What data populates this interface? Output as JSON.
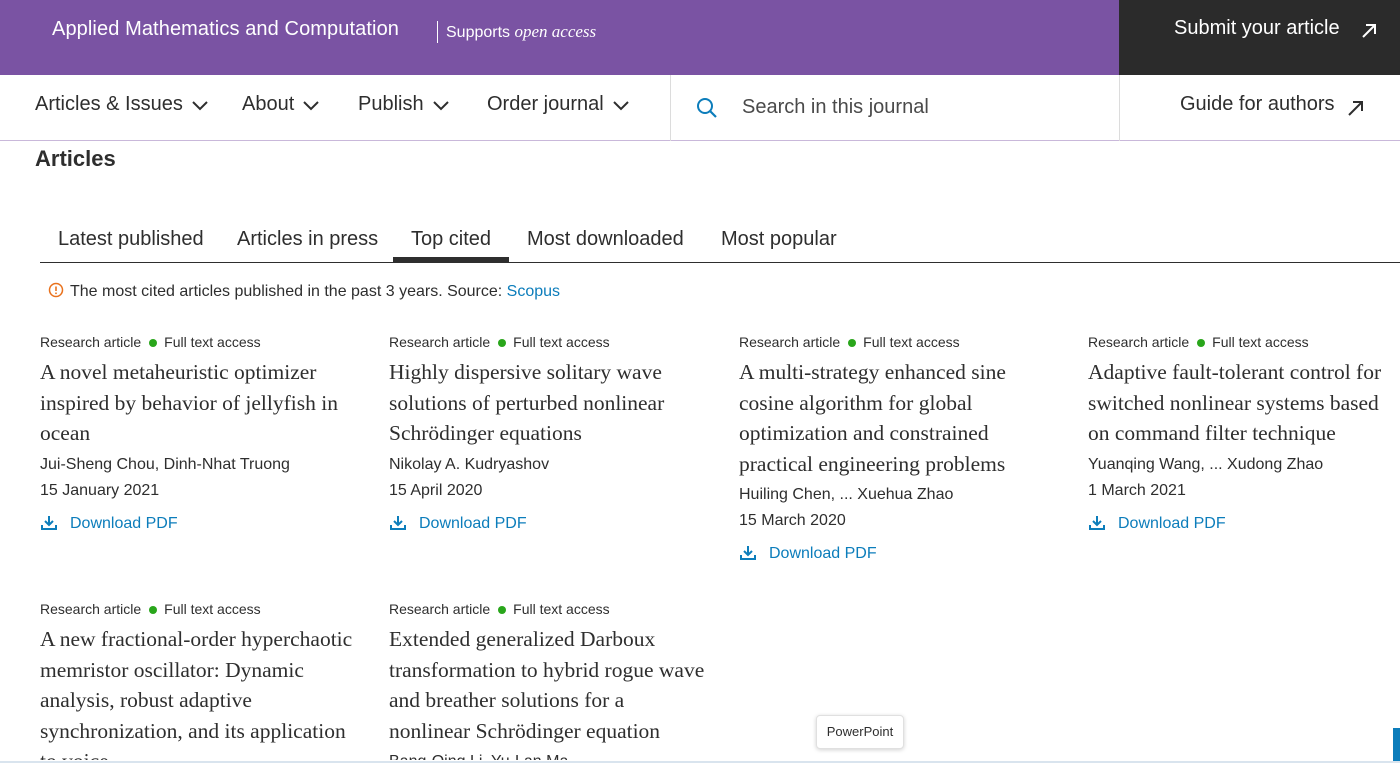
{
  "header": {
    "journal_title": "Applied Mathematics and Computation",
    "open_access_prefix": "Supports",
    "open_access_italic": "open access",
    "submit_label": "Submit your article",
    "brand_color": "#7a53a3",
    "submit_bg": "#2b2b2b"
  },
  "nav": {
    "items": [
      {
        "label": "Articles & Issues",
        "icon": "chevron-down-icon"
      },
      {
        "label": "About",
        "icon": "chevron-down-icon"
      },
      {
        "label": "Publish",
        "icon": "chevron-down-icon"
      },
      {
        "label": "Order journal",
        "icon": "chevron-down-icon"
      }
    ],
    "search_placeholder": "Search in this journal",
    "guide_label": "Guide for authors"
  },
  "section": {
    "title": "Articles"
  },
  "tabs": {
    "items": [
      "Latest published",
      "Articles in press",
      "Top cited",
      "Most downloaded",
      "Most popular"
    ],
    "active": "Top cited"
  },
  "info": {
    "text": "The most cited articles published in the past 3 years. Source: ",
    "link": "Scopus"
  },
  "articles": [
    {
      "type": "Research article",
      "access": "Full text access",
      "title": "A novel metaheuristic optimizer inspired by behavior of jellyfish in ocean",
      "authors": "Jui-Sheng Chou, Dinh-Nhat Truong",
      "date": "15 January 2021",
      "pdf_label": "Download PDF"
    },
    {
      "type": "Research article",
      "access": "Full text access",
      "title": "Highly dispersive solitary wave solutions of perturbed nonlinear Schrödinger equations",
      "authors": "Nikolay A. Kudryashov",
      "date": "15 April 2020",
      "pdf_label": "Download PDF"
    },
    {
      "type": "Research article",
      "access": "Full text access",
      "title": "A multi-strategy enhanced sine cosine algorithm for global optimization and constrained practical engineering problems",
      "authors": "Huiling Chen, ... Xuehua Zhao",
      "date": "15 March 2020",
      "pdf_label": "Download PDF"
    },
    {
      "type": "Research article",
      "access": "Full text access",
      "title": "Adaptive fault-tolerant control for switched nonlinear systems based on command filter technique",
      "authors": "Yuanqing Wang, ... Xudong Zhao",
      "date": "1 March 2021",
      "pdf_label": "Download PDF"
    },
    {
      "type": "Research article",
      "access": "Full text access",
      "title": "A new fractional-order hyperchaotic memristor oscillator: Dynamic analysis, robust adaptive synchronization, and its application to voice",
      "authors": "",
      "date": "",
      "pdf_label": ""
    },
    {
      "type": "Research article",
      "access": "Full text access",
      "title": "Extended generalized Darboux transformation to hybrid rogue wave and breather solutions for a nonlinear Schrödinger equation",
      "authors": "Bang-Qing Li, Yu-Lan Ma",
      "date": "",
      "pdf_label": ""
    }
  ],
  "tooltip": {
    "text": "PowerPoint"
  },
  "colors": {
    "link": "#0c7dbb",
    "access_dot": "#29a61b",
    "info_icon": "#e9711c"
  }
}
